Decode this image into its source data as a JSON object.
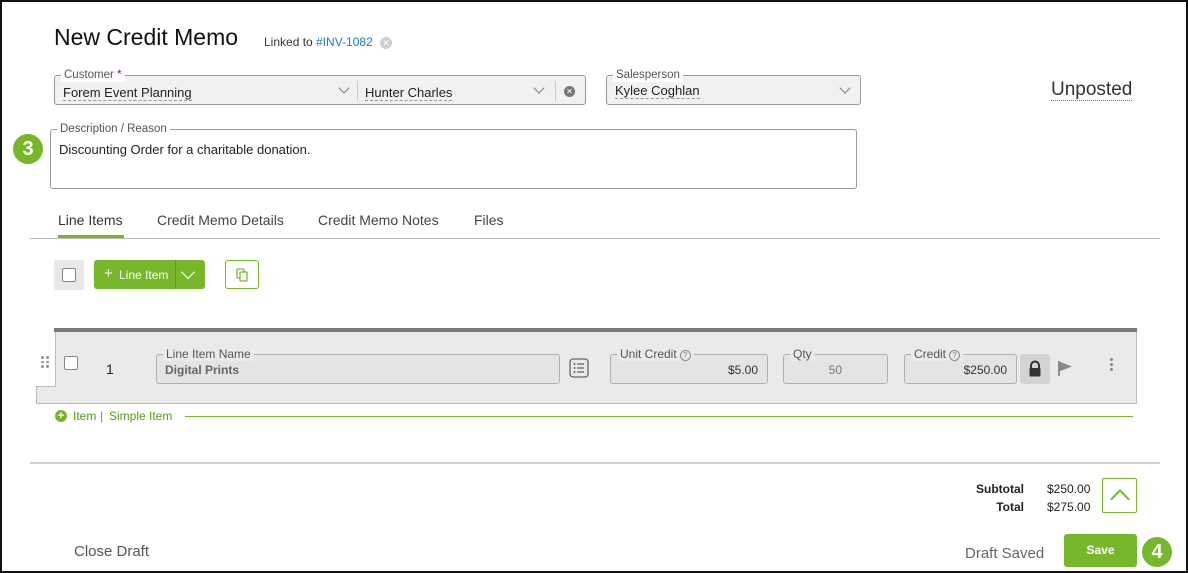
{
  "header": {
    "title": "New Credit Memo",
    "linked_prefix": "Linked to",
    "linked_invoice": "#INV-1082"
  },
  "customer": {
    "label": "Customer",
    "required_mark": "*",
    "company": "Forem Event Planning",
    "contact": "Hunter Charles"
  },
  "salesperson": {
    "label": "Salesperson",
    "value": "Kylee Coghlan"
  },
  "status": "Unposted",
  "description": {
    "label": "Description / Reason",
    "value": "Discounting Order for a charitable donation."
  },
  "callouts": {
    "step3": "3",
    "step4": "4"
  },
  "tabs": [
    {
      "label": "Line Items",
      "active": true
    },
    {
      "label": "Credit Memo Details",
      "active": false
    },
    {
      "label": "Credit Memo Notes",
      "active": false
    },
    {
      "label": "Files",
      "active": false
    }
  ],
  "toolbar": {
    "add_button_label": "Line Item"
  },
  "line_items": [
    {
      "number": "1",
      "name_label": "Line Item Name",
      "name": "Digital Prints",
      "unit_credit_label": "Unit Credit",
      "unit_credit": "$5.00",
      "qty_label": "Qty",
      "qty": "50",
      "credit_label": "Credit",
      "credit": "$250.00"
    }
  ],
  "add_links": {
    "item": "Item",
    "separator": "|",
    "simple_item": "Simple Item"
  },
  "totals": {
    "subtotal_label": "Subtotal",
    "subtotal_value": "$250.00",
    "total_label": "Total",
    "total_value": "$275.00"
  },
  "footer": {
    "close_draft": "Close Draft",
    "draft_saved": "Draft Saved",
    "save": "Save"
  },
  "colors": {
    "accent_green": "#76b82a",
    "link_blue": "#1d7cc2"
  }
}
